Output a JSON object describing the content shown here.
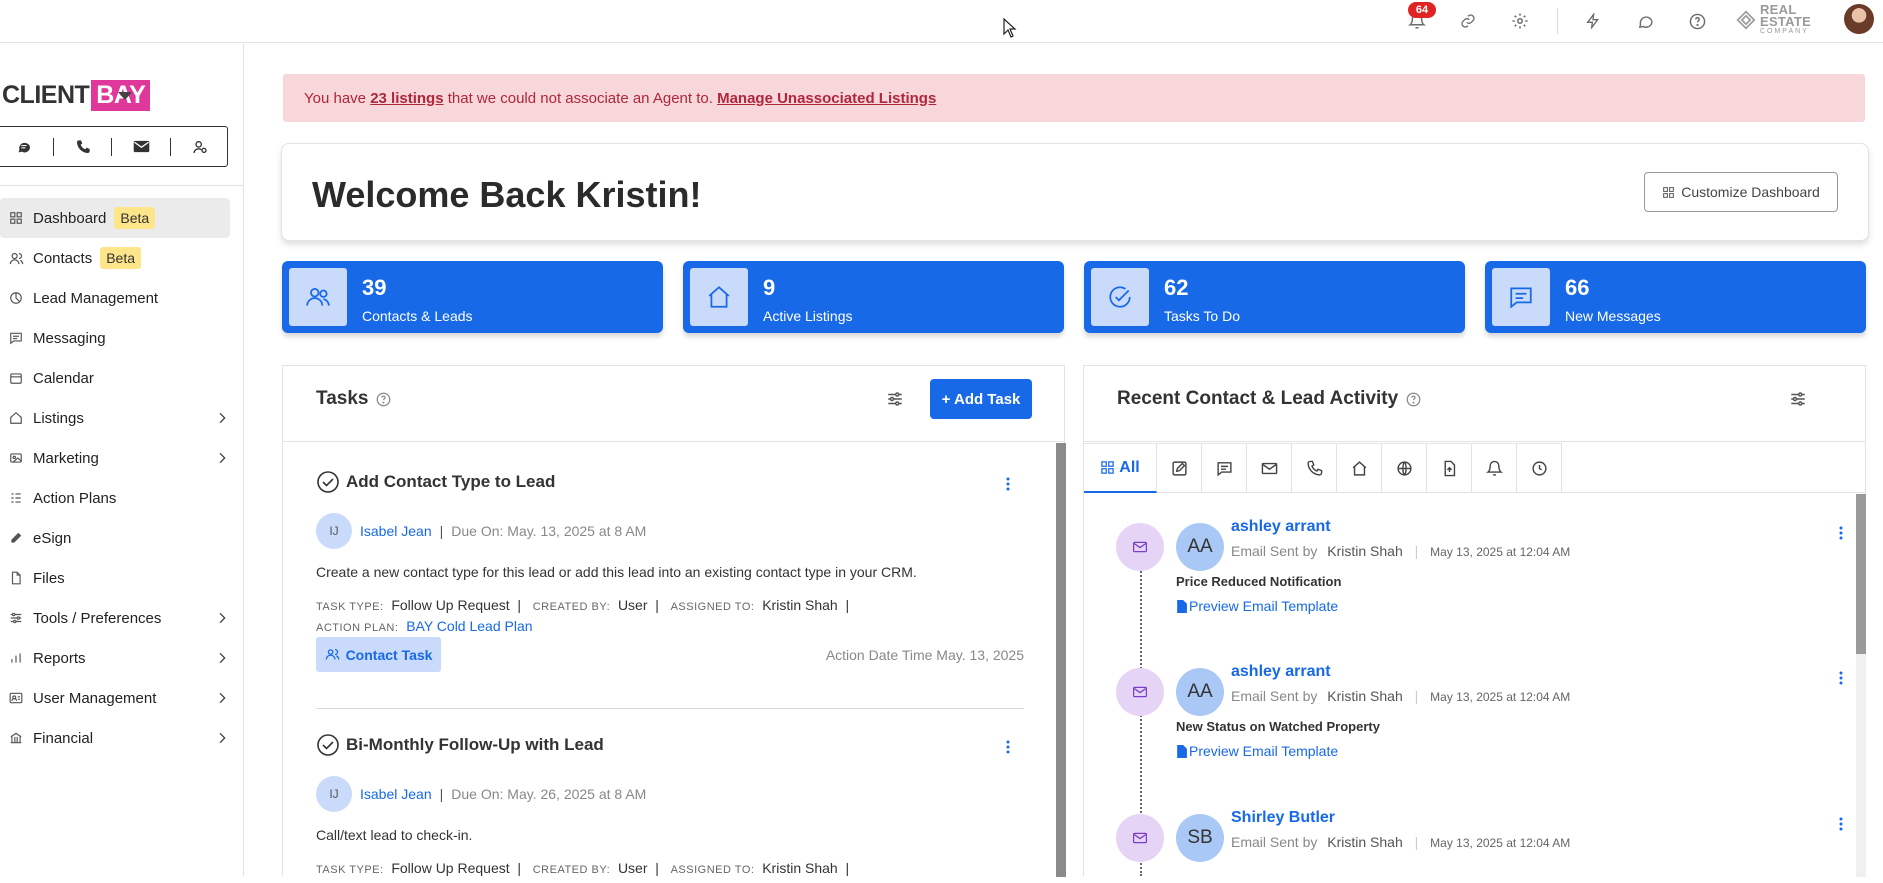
{
  "topbar": {
    "notification_count": "64",
    "brand_logo_text": "REAL ESTATE",
    "brand_logo_subtext": "COMPANY",
    "icons": [
      "bell-icon",
      "link-icon",
      "gear-icon",
      "lightning-icon",
      "chat-icon",
      "help-icon"
    ]
  },
  "sidebar": {
    "logo_client": "CLIENT",
    "logo_bay": "BAY",
    "logo_color": "#e0389a",
    "quick_actions": [
      "chat-icon",
      "phone-icon",
      "mail-icon",
      "contact-icon"
    ],
    "items": [
      {
        "label": "Dashboard",
        "badge": "Beta",
        "icon": "dashboard-icon",
        "active": true
      },
      {
        "label": "Contacts",
        "badge": "Beta",
        "icon": "contacts-icon"
      },
      {
        "label": "Lead Management",
        "icon": "lead-icon"
      },
      {
        "label": "Messaging",
        "icon": "messaging-icon"
      },
      {
        "label": "Calendar",
        "icon": "calendar-icon"
      },
      {
        "label": "Listings",
        "icon": "listings-icon",
        "expandable": true
      },
      {
        "label": "Marketing",
        "icon": "marketing-icon",
        "expandable": true
      },
      {
        "label": "Action Plans",
        "icon": "action-plans-icon"
      },
      {
        "label": "eSign",
        "icon": "pen-icon"
      },
      {
        "label": "Files",
        "icon": "files-icon"
      },
      {
        "label": "Tools / Preferences",
        "icon": "tools-icon",
        "expandable": true
      },
      {
        "label": "Reports",
        "icon": "reports-icon",
        "expandable": true
      },
      {
        "label": "User Management",
        "icon": "user-management-icon",
        "expandable": true
      },
      {
        "label": "Financial",
        "icon": "financial-icon",
        "expandable": true
      }
    ]
  },
  "alert": {
    "prefix": "You have",
    "count_link": "23 listings",
    "middle": "that we could not associate an Agent to.",
    "action_link": "Manage Unassociated Listings"
  },
  "welcome": {
    "title": "Welcome Back Kristin!",
    "customize_label": "Customize Dashboard"
  },
  "stats": [
    {
      "value": "39",
      "label": "Contacts & Leads",
      "icon": "people-icon"
    },
    {
      "value": "9",
      "label": "Active Listings",
      "icon": "house-icon"
    },
    {
      "value": "62",
      "label": "Tasks To Do",
      "icon": "check-circle-icon"
    },
    {
      "value": "66",
      "label": "New Messages",
      "icon": "message-icon"
    }
  ],
  "tasks": {
    "title": "Tasks",
    "add_label": "+ Add Task",
    "items": [
      {
        "title": "Add Contact Type to Lead",
        "initials": "IJ",
        "assignee": "Isabel Jean",
        "due": "Due On: May. 13, 2025 at 8 AM",
        "description": "Create a new contact type for this lead or add this lead into an existing contact type in your CRM.",
        "task_type_label": "TASK TYPE:",
        "task_type": "Follow Up Request",
        "created_by_label": "CREATED BY:",
        "created_by": "User",
        "assigned_to_label": "ASSIGNED TO:",
        "assigned_to": "Kristin Shah",
        "action_plan_label": "ACTION PLAN:",
        "action_plan": "BAY Cold Lead Plan",
        "tag": "Contact Task",
        "action_date": "Action Date Time May. 13, 2025"
      },
      {
        "title": "Bi-Monthly Follow-Up with Lead",
        "initials": "IJ",
        "assignee": "Isabel Jean",
        "due": "Due On: May. 26, 2025 at 8 AM",
        "description": "Call/text lead to check-in.",
        "task_type_label": "TASK TYPE:",
        "task_type": "Follow Up Request",
        "created_by_label": "CREATED BY:",
        "created_by": "User",
        "assigned_to_label": "ASSIGNED TO:",
        "assigned_to": "Kristin Shah"
      }
    ]
  },
  "activity": {
    "title": "Recent Contact & Lead Activity",
    "tab_all": "All",
    "tabs": [
      "note-icon",
      "chat-icon",
      "mail-icon",
      "phone-icon",
      "house-icon",
      "globe-icon",
      "file-icon",
      "bell-icon",
      "clock-icon"
    ],
    "items": [
      {
        "initials": "AA",
        "name": "ashley arrant",
        "action": "Email Sent by",
        "by": "Kristin Shah",
        "date": "May 13, 2025 at 12:04 AM",
        "subject": "Price Reduced Notification",
        "preview": "Preview Email Template"
      },
      {
        "initials": "AA",
        "name": "ashley arrant",
        "action": "Email Sent by",
        "by": "Kristin Shah",
        "date": "May 13, 2025 at 12:04 AM",
        "subject": "New Status on Watched Property",
        "preview": "Preview Email Template"
      },
      {
        "initials": "SB",
        "name": "Shirley Butler",
        "action": "Email Sent by",
        "by": "Kristin Shah",
        "date": "May 13, 2025 at 12:04 AM"
      }
    ]
  },
  "colors": {
    "accent": "#1769e8",
    "alert_bg": "#f8d7da",
    "alert_text": "#b0263a",
    "beta_bg": "#fde68a"
  }
}
